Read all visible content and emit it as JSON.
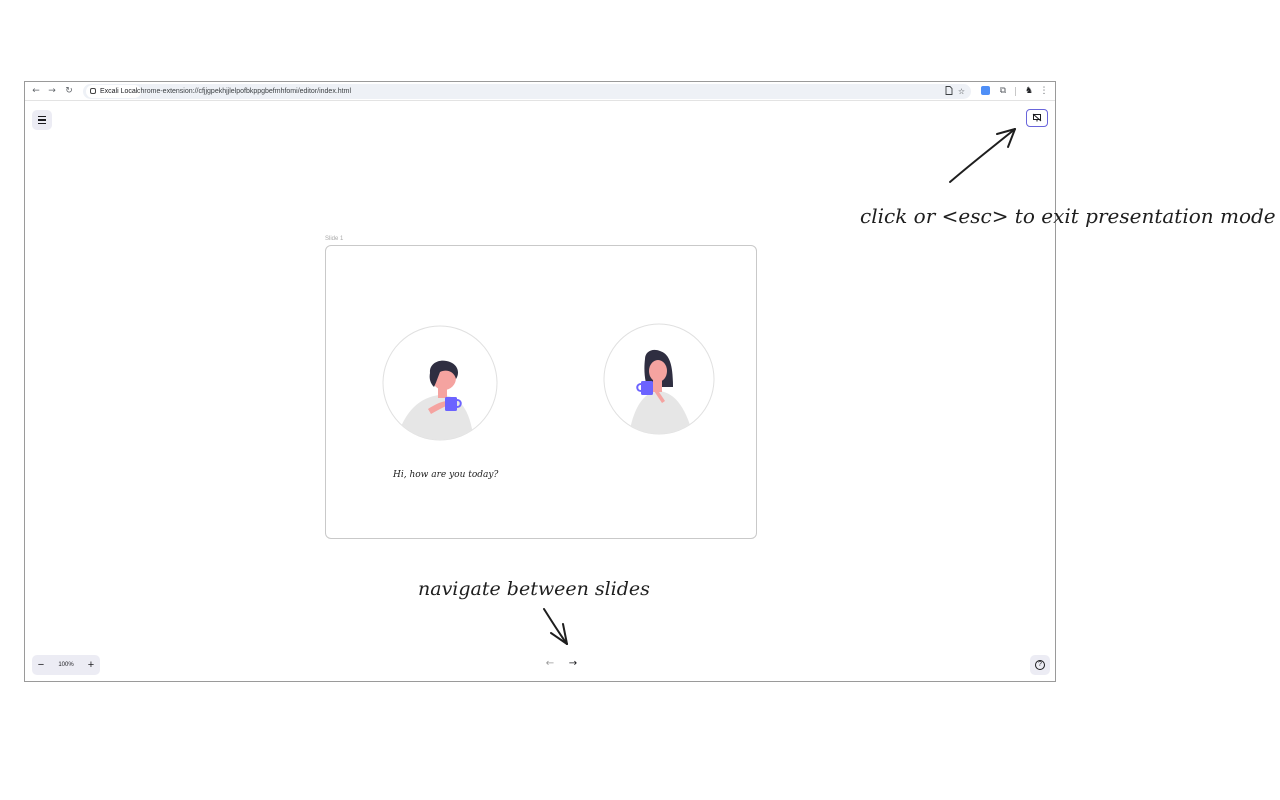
{
  "browser": {
    "site_chip": "Excali Local",
    "url": "chrome-extension://cfjjgpekhjjlelpofbkppgbefmhfomi/editor/index.html",
    "icons": {
      "back": "back-arrow-icon",
      "forward": "forward-arrow-icon",
      "reload": "reload-icon",
      "page_info": "page-info-icon",
      "bookmark": "star-icon",
      "extension": "extension-icon",
      "extensions_menu": "puzzle-icon",
      "profile": "profile-icon",
      "menu": "kebab-menu-icon"
    }
  },
  "app": {
    "slide_label": "Slide 1",
    "greeting": "Hi, how are you today?",
    "zoom": {
      "minus": "−",
      "level": "100%",
      "plus": "+"
    },
    "nav": {
      "prev": "←",
      "next": "→"
    },
    "help": "?",
    "colors": {
      "accent": "#6965db",
      "mug": "#6c63ff",
      "skin": "#f5a3a0",
      "hair": "#2f2e41",
      "sweater": "#e6e6e6"
    }
  },
  "annotations": {
    "exit_hint": "click or <esc> to exit presentation mode",
    "nav_hint": "navigate between slides"
  }
}
